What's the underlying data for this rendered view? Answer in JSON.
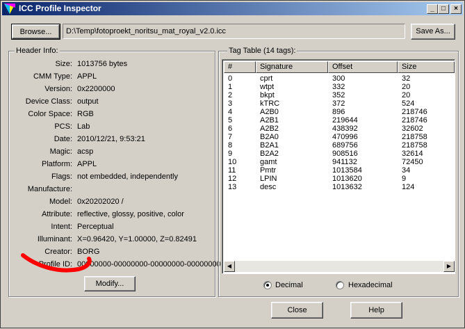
{
  "window": {
    "title": "ICC Profile Inspector",
    "minimize": "_",
    "maximize": "□",
    "close": "×"
  },
  "toolbar": {
    "browse_label": "Browse...",
    "path": "D:\\Temp\\fotoproekt_noritsu_mat_royal_v2.0.icc",
    "save_as_label": "Save As..."
  },
  "header_info": {
    "title": "Header Info:",
    "rows": [
      {
        "label": "Size:",
        "value": "1013756 bytes"
      },
      {
        "label": "CMM Type:",
        "value": "APPL"
      },
      {
        "label": "Version:",
        "value": "0x2200000"
      },
      {
        "label": "Device Class:",
        "value": "output"
      },
      {
        "label": "Color Space:",
        "value": "RGB"
      },
      {
        "label": "PCS:",
        "value": "Lab"
      },
      {
        "label": "Date:",
        "value": "2010/12/21, 9:53:21"
      },
      {
        "label": "Magic:",
        "value": "acsp"
      },
      {
        "label": "Platform:",
        "value": "APPL"
      },
      {
        "label": "Flags:",
        "value": "not embedded, independently"
      },
      {
        "label": "Manufacture:",
        "value": ""
      },
      {
        "label": "Model:",
        "value": "0x20202020 /"
      },
      {
        "label": "Attribute:",
        "value": "reflective, glossy, positive, color"
      },
      {
        "label": "Intent:",
        "value": "Perceptual"
      },
      {
        "label": "Illuminant:",
        "value": "X=0.96420, Y=1.00000, Z=0.82491"
      },
      {
        "label": "Creator:",
        "value": "BORG"
      },
      {
        "label": "Profile ID:",
        "value": "00000000-00000000-00000000-00000000"
      }
    ],
    "modify_label": "Modify..."
  },
  "tag_table": {
    "title": "Tag Table (14 tags):",
    "columns": [
      "#",
      "Signature",
      "Offset",
      "Size"
    ],
    "rows": [
      [
        "0",
        "cprt",
        "300",
        "32"
      ],
      [
        "1",
        "wtpt",
        "332",
        "20"
      ],
      [
        "2",
        "bkpt",
        "352",
        "20"
      ],
      [
        "3",
        "kTRC",
        "372",
        "524"
      ],
      [
        "4",
        "A2B0",
        "896",
        "218746"
      ],
      [
        "5",
        "A2B1",
        "219644",
        "218746"
      ],
      [
        "6",
        "A2B2",
        "438392",
        "32602"
      ],
      [
        "7",
        "B2A0",
        "470996",
        "218758"
      ],
      [
        "8",
        "B2A1",
        "689756",
        "218758"
      ],
      [
        "9",
        "B2A2",
        "908516",
        "32614"
      ],
      [
        "10",
        "gamt",
        "941132",
        "72450"
      ],
      [
        "11",
        "Pmtr",
        "1013584",
        "34"
      ],
      [
        "12",
        "LPIN",
        "1013620",
        "9"
      ],
      [
        "13",
        "desc",
        "1013632",
        "124"
      ]
    ],
    "scroll_left": "◀",
    "scroll_right": "▶",
    "radio_decimal": "Decimal",
    "radio_hex": "Hexadecimal",
    "selected_format": "Decimal"
  },
  "footer": {
    "close_label": "Close",
    "help_label": "Help"
  },
  "colors": {
    "title_start": "#0a246a",
    "title_end": "#a6caf0",
    "face": "#d4d0c8",
    "annotation": "#ff0000"
  }
}
